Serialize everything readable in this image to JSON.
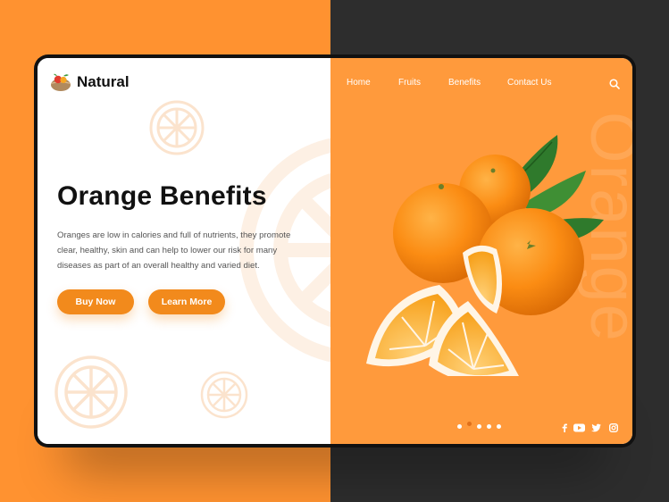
{
  "brand": {
    "name": "Natural"
  },
  "nav": {
    "items": [
      {
        "label": "Home"
      },
      {
        "label": "Fruits"
      },
      {
        "label": "Benefits"
      },
      {
        "label": "Contact Us"
      }
    ]
  },
  "hero": {
    "title": "Orange Benefits",
    "description": "Oranges are low in calories and full of nutrients, they promote clear, healthy, skin and can help to lower our risk for many diseases as part of an overall healthy and varied diet.",
    "buy_label": "Buy Now",
    "learn_label": "Learn More"
  },
  "side": {
    "watermark": "Orange"
  },
  "slider": {
    "count": 5,
    "active": 1
  },
  "social": [
    "facebook-icon",
    "youtube-icon",
    "twitter-icon",
    "instagram-icon"
  ],
  "colors": {
    "left_bg": "#ff9230",
    "right_bg": "#2d2d2d",
    "accent": "#f28a1c",
    "panel": "#ff9a3c"
  }
}
